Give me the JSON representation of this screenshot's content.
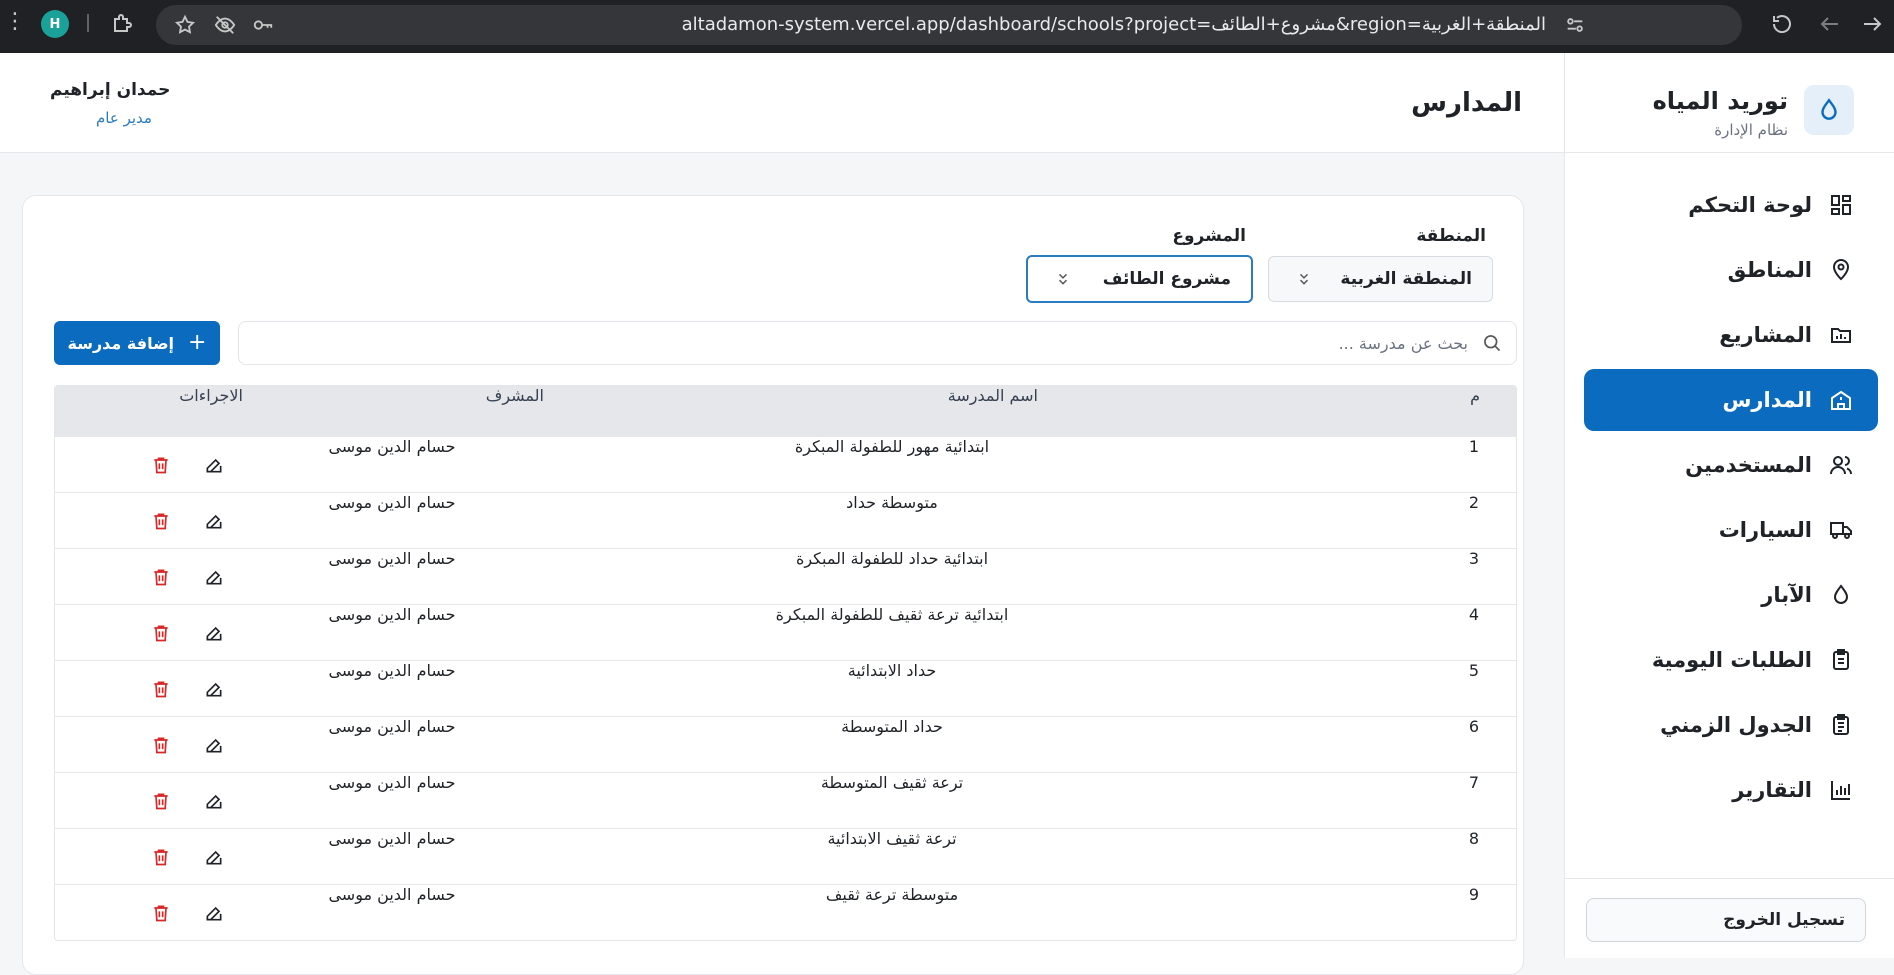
{
  "browser": {
    "url": "altadamon-system.vercel.app/dashboard/schools?project=مشروع+الطائف&region=المنطقة+الغربية",
    "profile_initial": "H"
  },
  "brand": {
    "name": "توريد المياه",
    "subtitle": "نظام الإدارة"
  },
  "sidebar": {
    "items": [
      {
        "label": "لوحة التحكم",
        "icon": "grid-icon",
        "active": false
      },
      {
        "label": "المناطق",
        "icon": "map-pin-icon",
        "active": false
      },
      {
        "label": "المشاريع",
        "icon": "folder-icon",
        "active": false
      },
      {
        "label": "المدارس",
        "icon": "school-icon",
        "active": true
      },
      {
        "label": "المستخدمين",
        "icon": "users-icon",
        "active": false
      },
      {
        "label": "السيارات",
        "icon": "truck-icon",
        "active": false
      },
      {
        "label": "الآبار",
        "icon": "droplet-icon",
        "active": false
      },
      {
        "label": "الطلبات اليومية",
        "icon": "clipboard-icon",
        "active": false
      },
      {
        "label": "الجدول الزمني",
        "icon": "clipboard-list-icon",
        "active": false
      },
      {
        "label": "التقارير",
        "icon": "bar-chart-icon",
        "active": false
      }
    ],
    "logout_label": "تسجيل الخروج"
  },
  "header": {
    "title": "المدارس",
    "user_name": "حمدان إبراهيم",
    "user_role": "مدير عام"
  },
  "filters": {
    "region_label": "المنطقة",
    "region_value": "المنطقة الغربية",
    "project_label": "المشروع",
    "project_value": "مشروع الطائف"
  },
  "search": {
    "placeholder": "بحث عن مدرسة ..."
  },
  "add_button_label": "إضافة مدرسة",
  "table": {
    "headers": {
      "num": "م",
      "name": "اسم المدرسة",
      "supervisor": "المشرف",
      "actions": "الاجراءات"
    },
    "rows": [
      {
        "num": "1",
        "name": "ابتدائية مهور للطفولة المبكرة",
        "supervisor": "حسام الدين موسى"
      },
      {
        "num": "2",
        "name": "متوسطة حداد",
        "supervisor": "حسام الدين موسى"
      },
      {
        "num": "3",
        "name": "ابتدائية حداد للطفولة المبكرة",
        "supervisor": "حسام الدين موسى"
      },
      {
        "num": "4",
        "name": "ابتدائية ترعة ثقيف للطفولة المبكرة",
        "supervisor": "حسام الدين موسى"
      },
      {
        "num": "5",
        "name": "حداد الابتدائية",
        "supervisor": "حسام الدين موسى"
      },
      {
        "num": "6",
        "name": "حداد المتوسطة",
        "supervisor": "حسام الدين موسى"
      },
      {
        "num": "7",
        "name": "ترعة ثقيف المتوسطة",
        "supervisor": "حسام الدين موسى"
      },
      {
        "num": "8",
        "name": "ترعة ثقيف الابتدائية",
        "supervisor": "حسام الدين موسى"
      },
      {
        "num": "9",
        "name": "متوسطة ترعة ثقيف",
        "supervisor": "حسام الدين موسى"
      }
    ]
  },
  "colors": {
    "primary": "#0b6bbf",
    "danger": "#dc2626",
    "header_bg": "#e5e7eb"
  }
}
